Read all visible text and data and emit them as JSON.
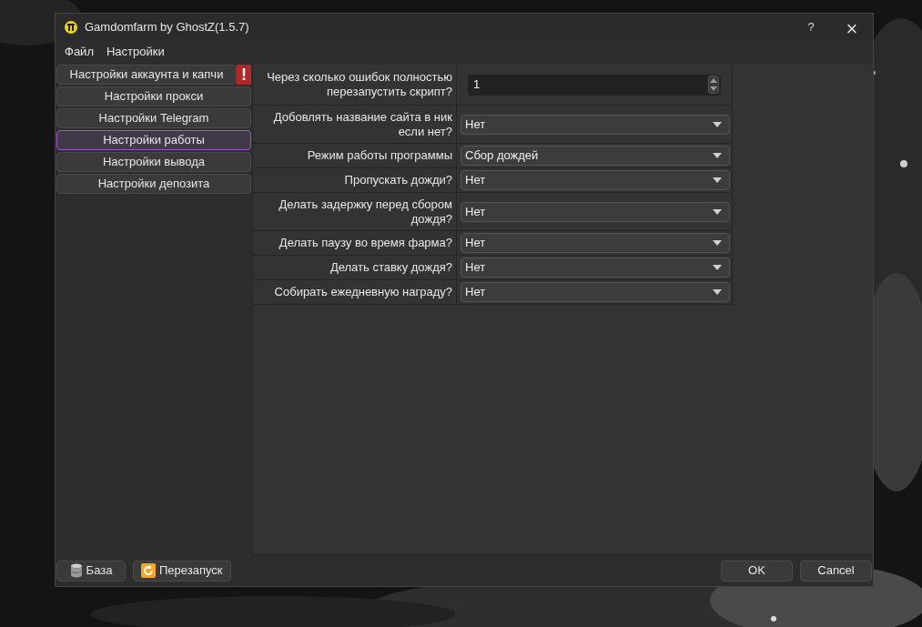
{
  "window": {
    "title": "Gamdomfarm by GhostZ(1.5.7)",
    "help": "?",
    "close": "×"
  },
  "menu": [
    "Файл",
    "Настройки"
  ],
  "sidebar": {
    "items": [
      {
        "label": "Настройки аккаунта и капчи",
        "selected": false,
        "warning": true,
        "warning_text": "!"
      },
      {
        "label": "Настройки прокси",
        "selected": false,
        "warning": false
      },
      {
        "label": "Настройки Telegram",
        "selected": false,
        "warning": false
      },
      {
        "label": "Настройки работы",
        "selected": true,
        "warning": false
      },
      {
        "label": "Настройки вывода",
        "selected": false,
        "warning": false
      },
      {
        "label": "Настройки депозита",
        "selected": false,
        "warning": false
      }
    ]
  },
  "settings": [
    {
      "kind": "spin",
      "label": "Через сколько ошибок полностью перезапустить скрипт?",
      "value": "1"
    },
    {
      "kind": "combo",
      "label": "Добовлять название сайта в ник если нет?",
      "value": "Нет"
    },
    {
      "kind": "combo",
      "label": "Режим работы программы",
      "value": "Сбор дождей"
    },
    {
      "kind": "combo",
      "label": "Пропускать дожди?",
      "value": "Нет"
    },
    {
      "kind": "combo",
      "label": "Делать задержку перед сбором дождя?",
      "value": "Нет"
    },
    {
      "kind": "combo",
      "label": "Делать паузу во время фарма?",
      "value": "Нет"
    },
    {
      "kind": "combo",
      "label": "Делать ставку дождя?",
      "value": "Нет"
    },
    {
      "kind": "combo",
      "label": "Собирать ежедневную награду?",
      "value": "Нет"
    }
  ],
  "footer": {
    "left": [
      {
        "kind": "database",
        "label": "База"
      },
      {
        "kind": "restart",
        "label": "Перезапуск"
      }
    ],
    "right": [
      "OK",
      "Cancel"
    ]
  }
}
